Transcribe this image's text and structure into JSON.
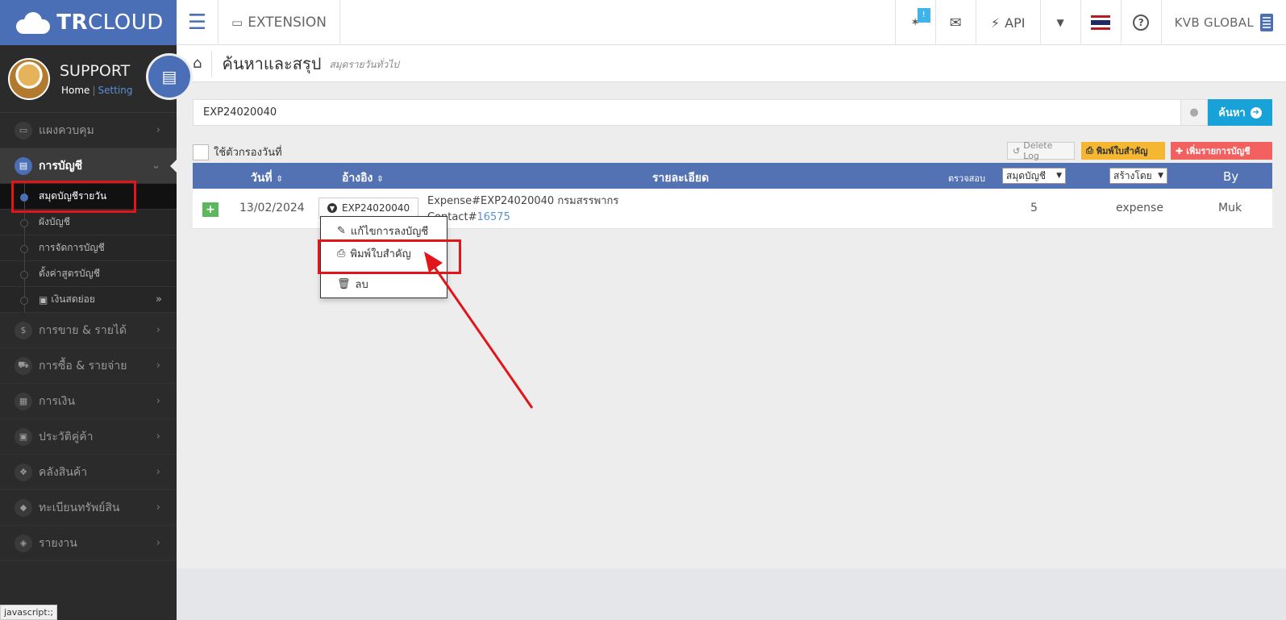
{
  "topbar": {
    "brand_bold": "TR",
    "brand_rest": "CLOUD",
    "extension_label": "EXTENSION",
    "notification_badge": "!",
    "api_label": "API",
    "company": "KVB GLOBAL"
  },
  "sidebar": {
    "profile_name": "SUPPORT",
    "home_link": "Home",
    "separator": "|",
    "setting_link": "Setting",
    "items_top": [
      {
        "label": "แผงควบคุม",
        "icon": "monitor-icon"
      }
    ],
    "active_item": {
      "label": "การบัญชี",
      "icon": "book-icon"
    },
    "sub_items": [
      {
        "label": "สมุดบัญชีรายวัน"
      },
      {
        "label": "ผังบัญชี"
      },
      {
        "label": "การจัดการบัญชี"
      },
      {
        "label": "ตั้งค่าสูตรบัญชี"
      },
      {
        "label": "เงินสดย่อย"
      }
    ],
    "items_bottom": [
      {
        "label": "การขาย & รายได้",
        "icon": "dollar-icon"
      },
      {
        "label": "การซื้อ & รายจ่าย",
        "icon": "cart-icon"
      },
      {
        "label": "การเงิน",
        "icon": "calendar-icon"
      },
      {
        "label": "ประวัติคู่ค้า",
        "icon": "contact-icon"
      },
      {
        "label": "คลังสินค้า",
        "icon": "cubes-icon"
      },
      {
        "label": "ทะเบียนทรัพย์สิน",
        "icon": "diamond-icon"
      },
      {
        "label": "รายงาน",
        "icon": "report-icon"
      }
    ],
    "status_tip": "javascript:;"
  },
  "page": {
    "title": "ค้นหาและสรุป",
    "subtitle": "สมุดรายวันทั่วไป"
  },
  "search": {
    "value": "EXP24020040",
    "button_label": "ค้นหา"
  },
  "toolbar": {
    "date_filter_label": "ใช้ตัวกรองวันที่",
    "delete_log": "Delete Log",
    "print_doc": "พิมพ์ใบสำคัญ",
    "add_entry": "เพิ่มรายการบัญชี"
  },
  "table": {
    "headers": {
      "date": "วันที่",
      "ref": "อ้างอิง",
      "detail": "รายละเอียด",
      "check": "ตรวจสอบ",
      "book_select": "สมุดบัญชี",
      "creator_select": "สร้างโดย",
      "by": "By"
    },
    "row": {
      "date": "13/02/2024",
      "ref": "EXP24020040",
      "detail_line1": "Expense#EXP24020040 กรมสรรพากร",
      "detail_line2_prefix": "Contact#",
      "detail_line2_link": "16575",
      "check": "5",
      "creator": "expense",
      "by": "Muk"
    }
  },
  "dropdown": {
    "edit": "แก้ไขการลงบัญชี",
    "print": "พิมพ์ใบสำคัญ",
    "delete": "ลบ"
  }
}
